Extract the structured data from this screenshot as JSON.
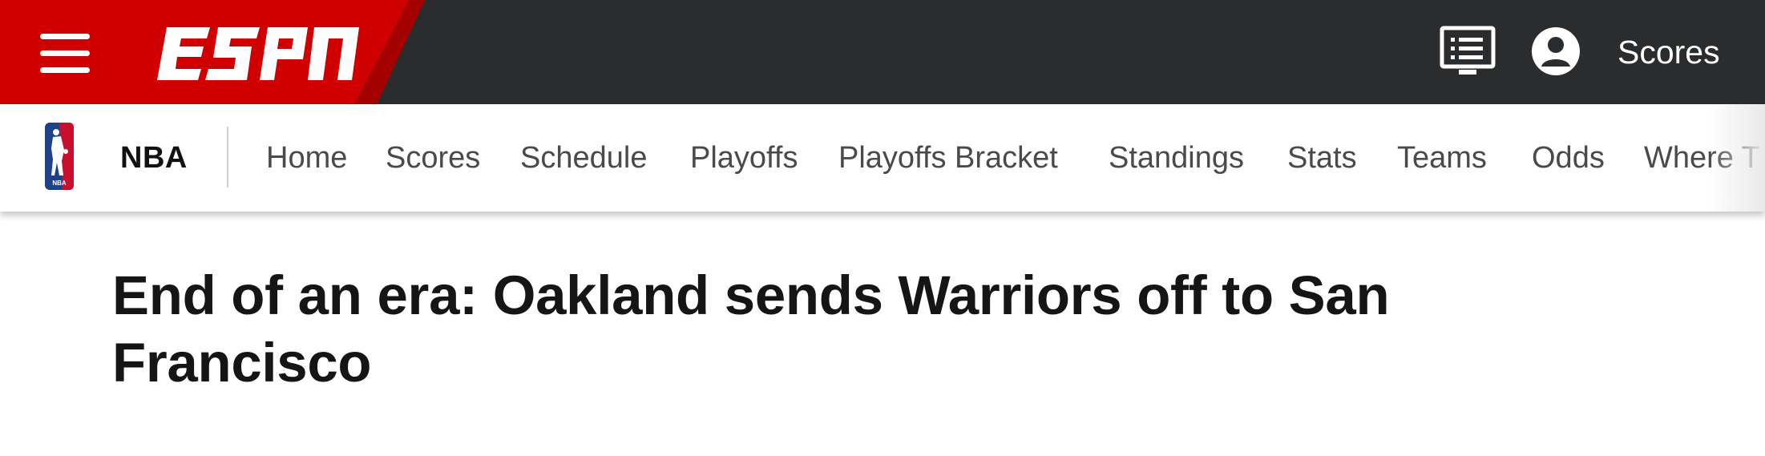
{
  "header": {
    "brand": "ESPN",
    "scores_label": "Scores",
    "colors": {
      "brand_red": "#d00000",
      "bar_bg": "#2b2c2d"
    }
  },
  "icons": {
    "menu": "hamburger-menu-icon",
    "tv": "tv-guide-icon",
    "user": "user-account-icon",
    "league": "nba-logo-icon"
  },
  "subnav": {
    "league": "NBA",
    "items": [
      {
        "label": "Home"
      },
      {
        "label": "Scores"
      },
      {
        "label": "Schedule"
      },
      {
        "label": "Playoffs"
      },
      {
        "label": "Playoffs Bracket"
      },
      {
        "label": "Standings"
      },
      {
        "label": "Stats"
      },
      {
        "label": "Teams"
      },
      {
        "label": "Odds"
      },
      {
        "label": "Where T"
      }
    ]
  },
  "article": {
    "headline": "End of an era: Oakland sends Warriors off to San Francisco"
  }
}
